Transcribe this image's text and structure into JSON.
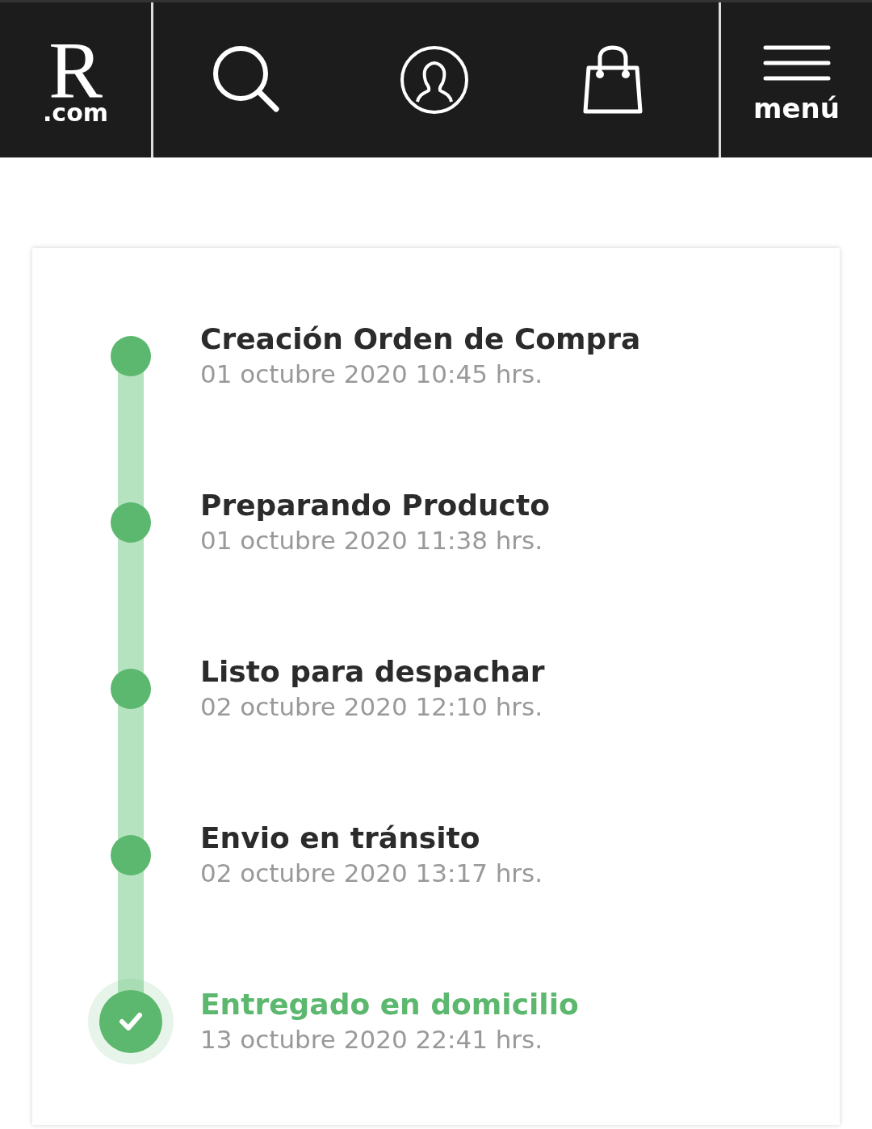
{
  "header": {
    "logo": {
      "letter": "R",
      "domain": ".com"
    },
    "menu_label": "menú"
  },
  "timeline": [
    {
      "title": "Creación Orden de Compra",
      "date": "01 octubre 2020 10:45 hrs.",
      "current": false
    },
    {
      "title": "Preparando Producto",
      "date": "01 octubre 2020 11:38 hrs.",
      "current": false
    },
    {
      "title": "Listo para despachar",
      "date": "02 octubre 2020 12:10 hrs.",
      "current": false
    },
    {
      "title": "Envio en tránsito",
      "date": "02 octubre 2020 13:17 hrs.",
      "current": false
    },
    {
      "title": "Entregado en domicilio",
      "date": "13 octubre 2020 22:41 hrs.",
      "current": true
    }
  ]
}
